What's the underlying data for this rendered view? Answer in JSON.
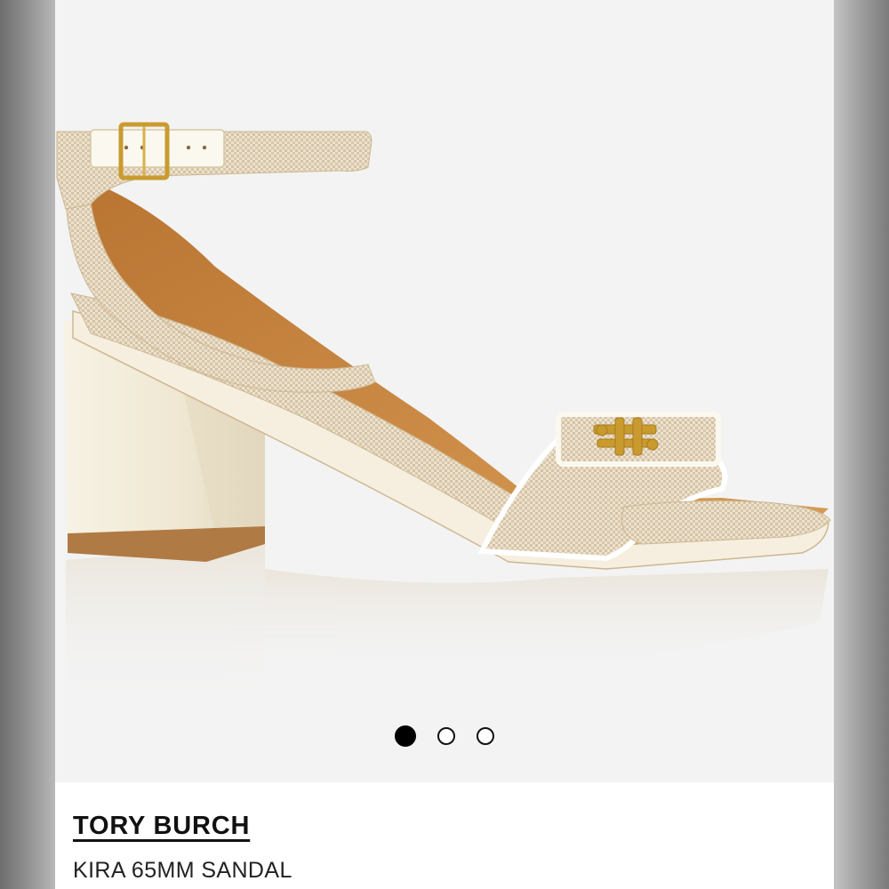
{
  "product": {
    "brand": "TORY BURCH",
    "name": "KIRA 65MM SANDAL"
  },
  "gallery": {
    "image_subject": "sandal-image",
    "slide_count": 3,
    "active_slide": 1
  },
  "colors": {
    "background_gray": "#7d7d7d",
    "active_dot": "#000000",
    "canvas_fabric": "#e4d6c0",
    "leather_tan": "#c8873f",
    "heel_cream": "#f1ead6",
    "hardware_gold": "#c99b2f"
  }
}
